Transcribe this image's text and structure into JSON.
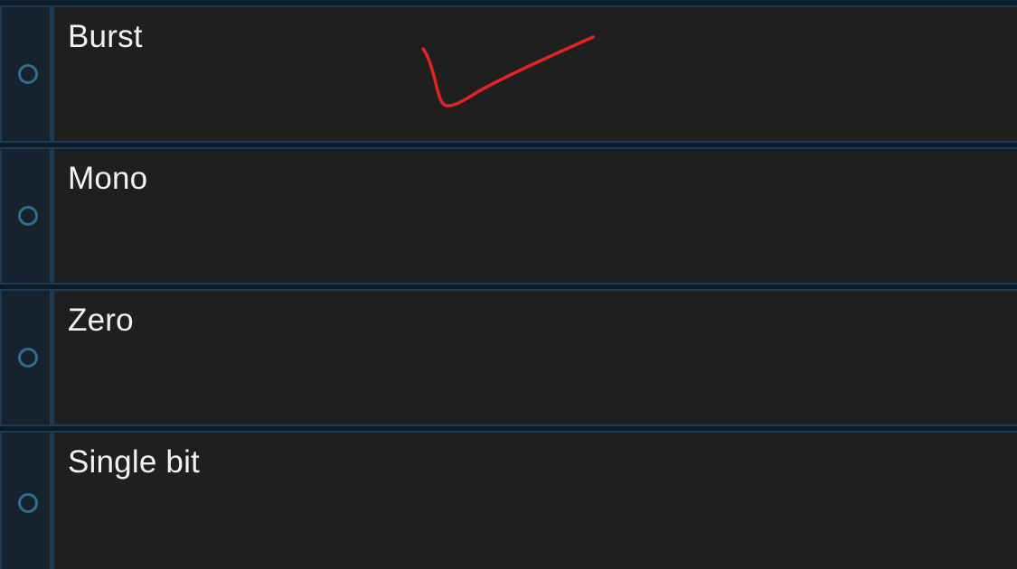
{
  "options": [
    {
      "label": "Burst",
      "selected": false
    },
    {
      "label": "Mono",
      "selected": false
    },
    {
      "label": "Zero",
      "selected": false
    },
    {
      "label": "Single bit",
      "selected": false
    }
  ],
  "annotation": {
    "type": "hand-drawn-checkmark",
    "color": "#e02424",
    "marks_option": "Burst"
  }
}
